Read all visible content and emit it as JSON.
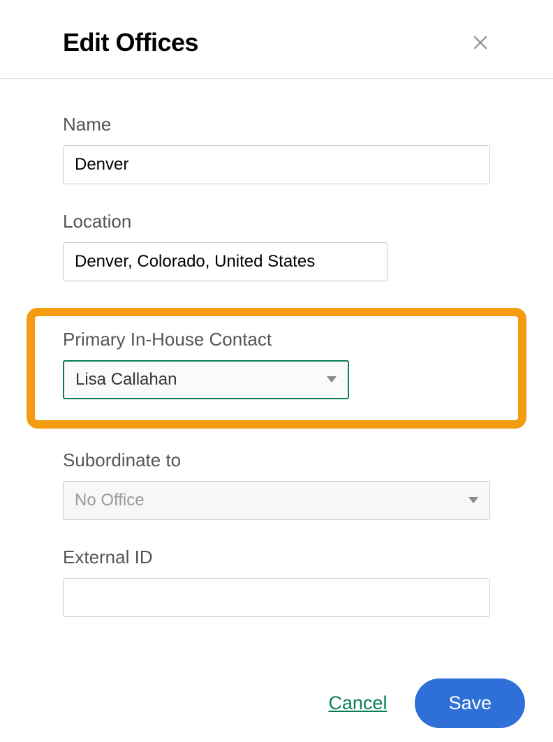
{
  "header": {
    "title": "Edit Offices"
  },
  "form": {
    "name": {
      "label": "Name",
      "value": "Denver"
    },
    "location": {
      "label": "Location",
      "value": "Denver, Colorado, United States"
    },
    "primary_contact": {
      "label": "Primary In-House Contact",
      "value": "Lisa Callahan"
    },
    "subordinate": {
      "label": "Subordinate to",
      "value": "No Office"
    },
    "external_id": {
      "label": "External ID",
      "value": ""
    }
  },
  "footer": {
    "cancel_label": "Cancel",
    "save_label": "Save"
  }
}
